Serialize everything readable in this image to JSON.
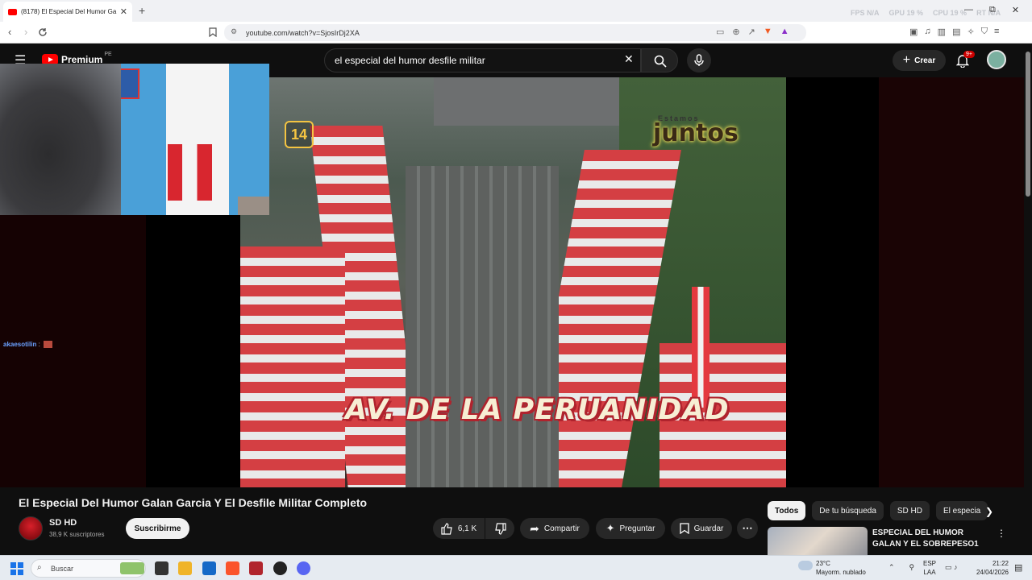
{
  "browser": {
    "tab_title": "(8178) El Especial Del Humor Ga",
    "tab_close": "✕",
    "new_tab": "+",
    "url": "youtube.com/watch?v=SjosIrDj2XA",
    "overlay_stats": [
      "FPS N/A",
      "GPU 19 %",
      "CPU 19 %",
      "RT N/A"
    ],
    "window_controls": [
      "—",
      "⧉",
      "✕"
    ]
  },
  "youtube": {
    "logo_text": "Premium",
    "logo_region": "PE",
    "search_query": "el especial del humor desfile militar",
    "create_label": "Crear",
    "notification_count": "9+"
  },
  "video": {
    "overlay_text": "AV. DE LA PERUANIDAD",
    "channel_number": "14",
    "watermark_small": "Estamos",
    "watermark": "juntos"
  },
  "webcam_chat": {
    "username": "akaesotilin",
    "separator": " :"
  },
  "details": {
    "title": "El Especial Del Humor Galan Garcia Y El Desfile Militar Completo",
    "channel_name": "SD HD",
    "subscribers": "38,9 K suscriptores",
    "subscribe_label": "Suscribirme",
    "likes": "6,1 K",
    "share_label": "Compartir",
    "ask_label": "Preguntar",
    "save_label": "Guardar",
    "more_label": "⋯"
  },
  "recommendations": {
    "chips": [
      "Todos",
      "De tu búsqueda",
      "SD HD",
      "El especia"
    ],
    "first_title": "ESPECIAL DEL HUMOR GALAN Y EL SOBREPESO1"
  },
  "taskbar": {
    "search_placeholder": "Buscar",
    "weather_temp": "23°C",
    "weather_desc": "Mayorm. nublado",
    "lang_1": "ESP",
    "lang_2": "LAA",
    "time": "21:22",
    "date": "24/04/2026"
  },
  "colors": {
    "yt_red": "#ff0000",
    "background": "#0f0f0f",
    "peru_red": "#d43f43"
  }
}
